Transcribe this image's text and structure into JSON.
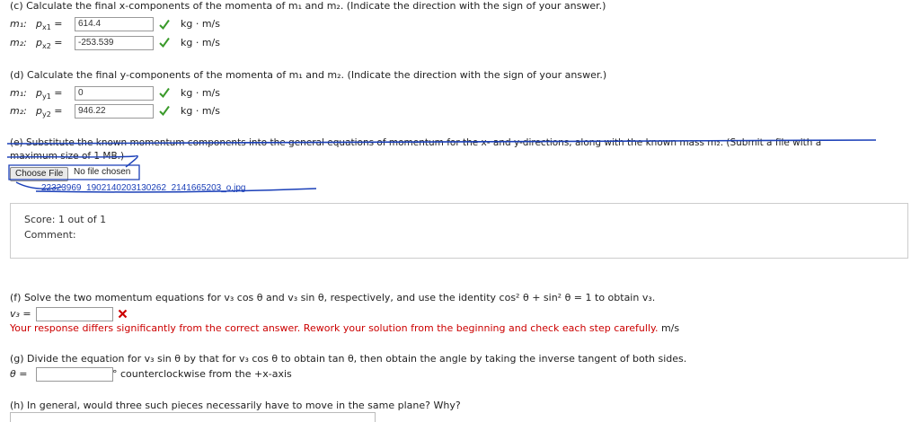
{
  "part_c": {
    "prompt": "(c) Calculate the final x-components of the momenta of m₁ and m₂. (Indicate the direction with the sign of your answer.)",
    "rows": [
      {
        "mass": "m₁:",
        "symbol": "p",
        "sub": "x1",
        "value": "614.4",
        "unit": "kg · m/s"
      },
      {
        "mass": "m₂:",
        "symbol": "p",
        "sub": "x2",
        "value": "-253.539",
        "unit": "kg · m/s"
      }
    ]
  },
  "part_d": {
    "prompt": "(d) Calculate the final y-components of the momenta of m₁ and m₂. (Indicate the direction with the sign of your answer.)",
    "rows": [
      {
        "mass": "m₁:",
        "symbol": "p",
        "sub": "y1",
        "value": "0",
        "unit": "kg · m/s"
      },
      {
        "mass": "m₂:",
        "symbol": "p",
        "sub": "y2",
        "value": "946.22",
        "unit": "kg · m/s"
      }
    ]
  },
  "part_e": {
    "prompt_line1": "(e) Substitute the known momentum components into the general equations of momentum for the x- and y-directions, along with the known mass m₂. (Submit a file with a",
    "prompt_line2": "maximum size of 1 MB.)",
    "choose_file_label": "Choose File",
    "no_file_label": "No file chosen",
    "filename": "22323969_1902140203130262_2141665203_o.jpg"
  },
  "score": {
    "score_text": "Score: 1 out of 1",
    "comment_text": "Comment:"
  },
  "part_f": {
    "prompt": "(f) Solve the two momentum equations for v₃ cos θ and v₃ sin θ, respectively, and use the identity cos² θ + sin² θ = 1 to obtain v₃.",
    "field_label": "v₃ =",
    "value": "",
    "feedback": "Your response differs significantly from the correct answer. Rework your solution from the beginning and check each step carefully.",
    "feedback_unit": "m/s"
  },
  "part_g": {
    "prompt": "(g) Divide the equation for v₃ sin θ by that for v₃ cos θ to obtain tan θ, then obtain the angle by taking the inverse tangent of both sides.",
    "field_label": "θ =",
    "value": "",
    "unit": "° counterclockwise from the +x-axis"
  },
  "part_h": {
    "prompt": "(h) In general, would three such pieces necessarily have to move in the same plane? Why?"
  },
  "colors": {
    "check_green": "#3a9a2a",
    "error_red": "#cc0000",
    "ink_blue": "#1a3fb8"
  }
}
